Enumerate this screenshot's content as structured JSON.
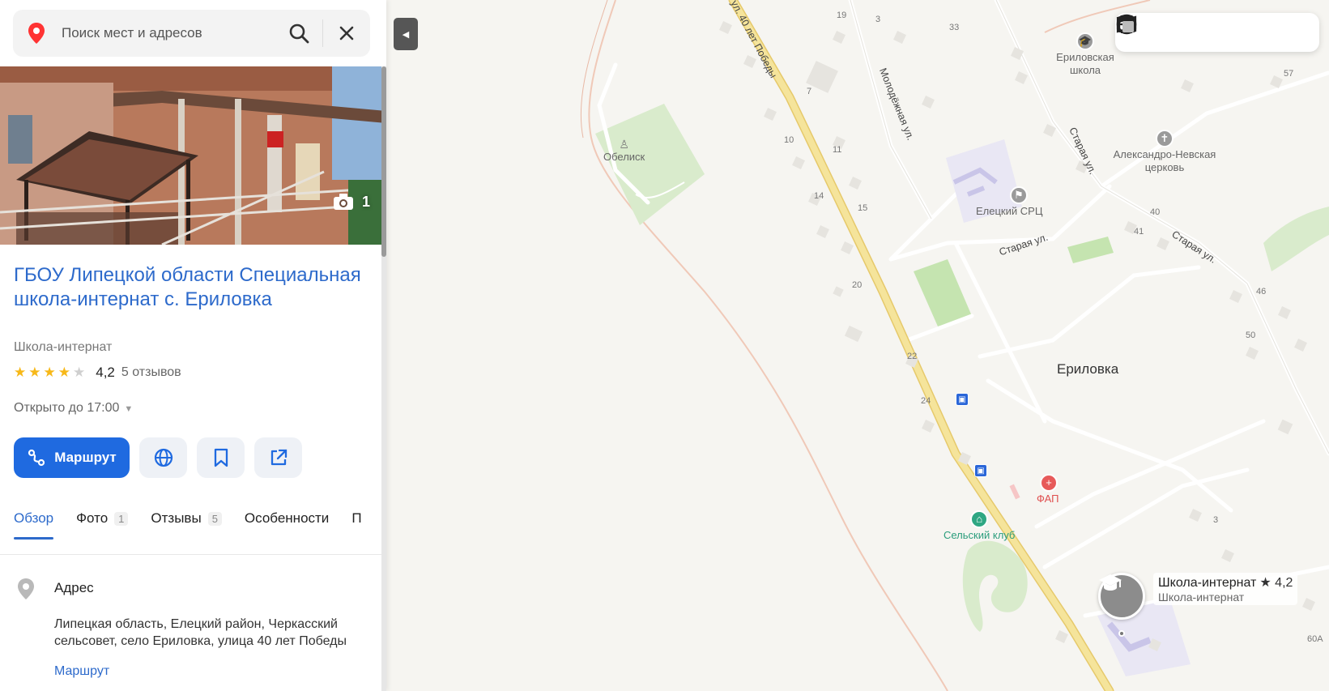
{
  "search": {
    "placeholder": "Поиск мест и адресов"
  },
  "photo": {
    "count": "1"
  },
  "org": {
    "title": "ГБОУ Липецкой области Специальная школа-интернат с. Ериловка",
    "category": "Школа-интернат",
    "rating_value": "4,2",
    "stars_filled": 4,
    "stars_total": 5,
    "reviews": "5 отзывов",
    "hours": "Открыто до 17:00"
  },
  "actions": {
    "route_label": "Маршрут",
    "icons": [
      "globe-icon",
      "bookmark-icon",
      "share-icon"
    ]
  },
  "tabs": [
    {
      "label": "Обзор",
      "count": "",
      "active": true
    },
    {
      "label": "Фото",
      "count": "1",
      "active": false
    },
    {
      "label": "Отзывы",
      "count": "5",
      "active": false
    },
    {
      "label": "Особенности",
      "count": "",
      "active": false
    },
    {
      "label": "П",
      "count": "",
      "active": false
    }
  ],
  "address": {
    "label": "Адрес",
    "text": "Липецкая область, Елецкий район, Черкасский сельсовет, село Ериловка, улица 40 лет Победы",
    "route_link": "Маршрут"
  },
  "map": {
    "village": "Ериловка",
    "streets": {
      "pobedy": "ул. 40 лет Победы",
      "molodezhnaya": "Молодёжная ул.",
      "staraya1": "Старая ул.",
      "staraya2": "Старая ул.",
      "staraya3": "Старая ул."
    },
    "pois": {
      "obelisk": "Обелиск",
      "school": "Ериловская школа",
      "church": "Александро-Невская церковь",
      "src": "Елецкий СРЦ",
      "fap": "ФАП",
      "club": "Сельский клуб"
    },
    "house_numbers": [
      "19",
      "3",
      "33",
      "7",
      "57",
      "10",
      "11",
      "14",
      "15",
      "40",
      "41",
      "20",
      "46",
      "50",
      "22",
      "24",
      "3",
      "60А"
    ],
    "selected": {
      "name": "Школа-интернат",
      "rating": "★ 4,2",
      "category": "Школа-интернат"
    },
    "layer_buttons": [
      "panorama-icon",
      "map-layers-icon",
      "photo-layer-icon",
      "transit-icon",
      "overlay-icon"
    ],
    "colors": {
      "main_road": "#f5e49b",
      "park": "#d9ebcc",
      "field": "#c5e4b0"
    }
  }
}
